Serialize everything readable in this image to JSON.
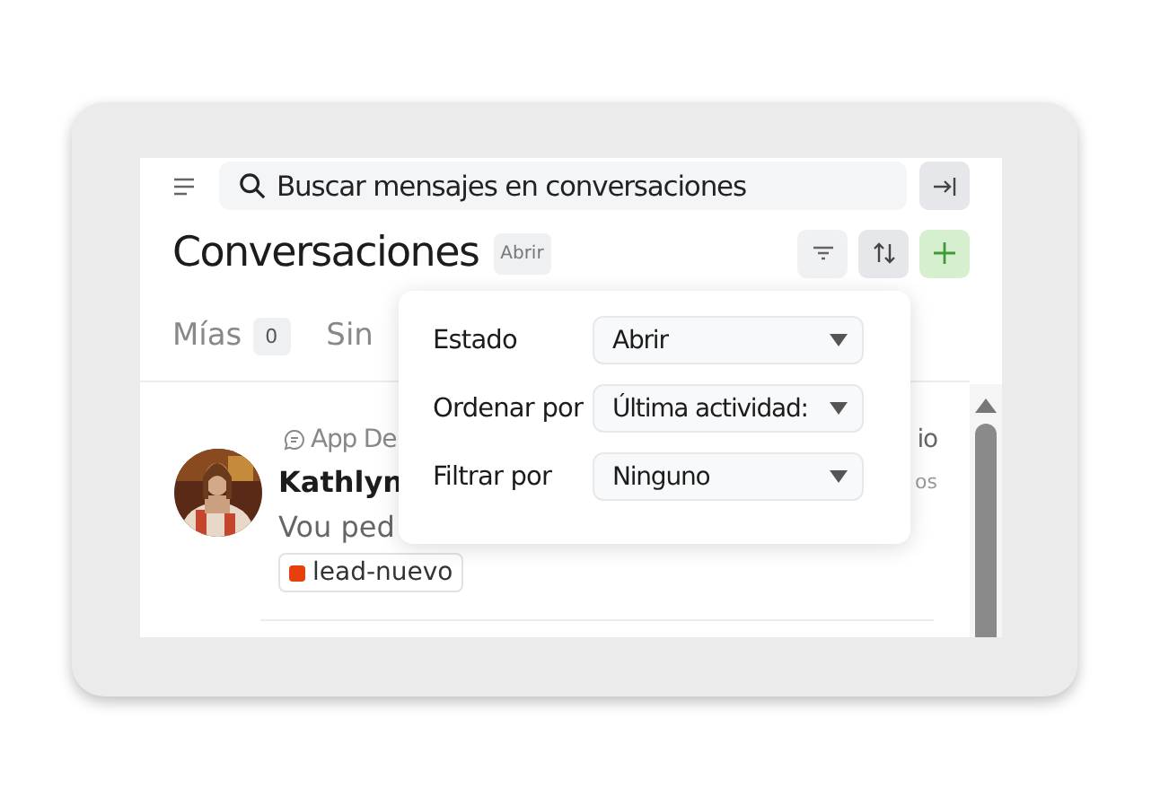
{
  "search": {
    "placeholder": "Buscar mensajes en conversaciones"
  },
  "title": "Conversaciones",
  "status_badge": "Abrir",
  "tabs": [
    {
      "label": "Mías",
      "count": "0",
      "selected": false
    },
    {
      "label": "Sin",
      "selected": false
    }
  ],
  "conversation": {
    "inbox": "App De",
    "inbox_end": "io",
    "name": "Kathlyn",
    "meta": "os",
    "preview": "Vou ped",
    "labels": [
      {
        "text": "lead-nuevo",
        "color": "#e8400c"
      }
    ]
  },
  "popup": {
    "rows": [
      {
        "label": "Estado",
        "value": "Abrir"
      },
      {
        "label": "Ordenar por",
        "value": "Última actividad:"
      },
      {
        "label": "Filtrar por",
        "value": "Ninguno"
      }
    ]
  }
}
